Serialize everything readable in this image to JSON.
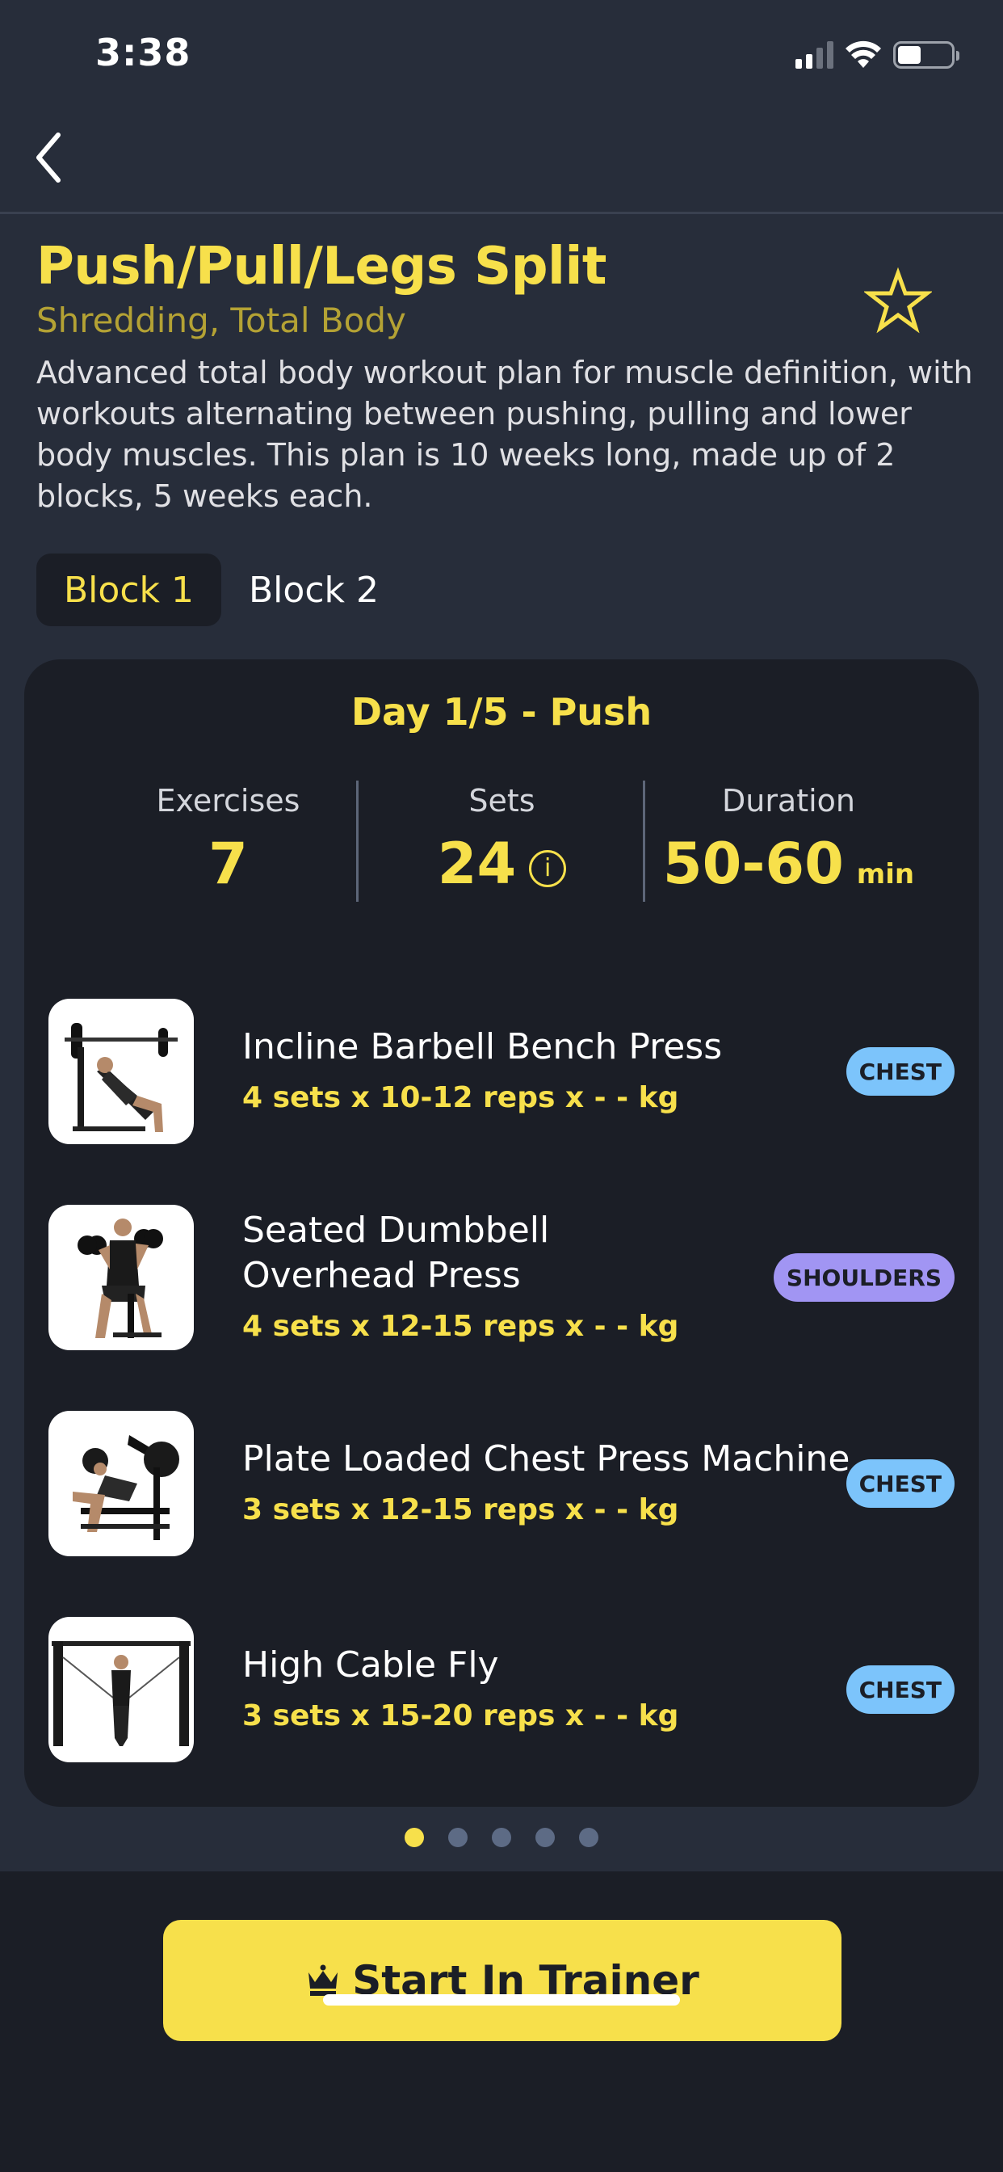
{
  "status_bar": {
    "time": "3:38"
  },
  "plan": {
    "title": "Push/Pull/Legs Split",
    "subtitle": "Shredding, Total Body",
    "description": "Advanced total body workout plan for muscle definition, with workouts alternating between pushing, pulling and lower body muscles. This plan is 10 weeks long, made up of 2 blocks, 5 weeks each."
  },
  "blocks": [
    {
      "label": "Block 1",
      "active": true
    },
    {
      "label": "Block 2",
      "active": false
    }
  ],
  "day": {
    "title": "Day 1/5 - Push",
    "stats": {
      "exercises": {
        "label": "Exercises",
        "value": "7"
      },
      "sets": {
        "label": "Sets",
        "value": "24",
        "info_icon": "info-icon"
      },
      "duration": {
        "label": "Duration",
        "value": "50-60",
        "unit": "min"
      }
    },
    "exercises": [
      {
        "name": "Incline Barbell Bench Press",
        "detail": "4 sets x 10-12 reps x - - kg",
        "tag": "CHEST",
        "tag_color": "#7cc4fb"
      },
      {
        "name": "Seated Dumbbell Overhead Press",
        "detail": "4 sets x 12-15 reps x - - kg",
        "tag": "SHOULDERS",
        "tag_color": "#a195f3"
      },
      {
        "name": "Plate Loaded Chest Press Machine",
        "detail": "3 sets x 12-15 reps x - - kg",
        "tag": "CHEST",
        "tag_color": "#7cc4fb"
      },
      {
        "name": "High Cable Fly",
        "detail": "3 sets x 15-20 reps x - - kg",
        "tag": "CHEST",
        "tag_color": "#7cc4fb"
      }
    ]
  },
  "pager": {
    "total": 5,
    "current": 1
  },
  "actions": {
    "start_label": "Start In Trainer"
  },
  "colors": {
    "accent": "#f7e04b",
    "background": "#272d3a",
    "card": "#1b1e26"
  }
}
